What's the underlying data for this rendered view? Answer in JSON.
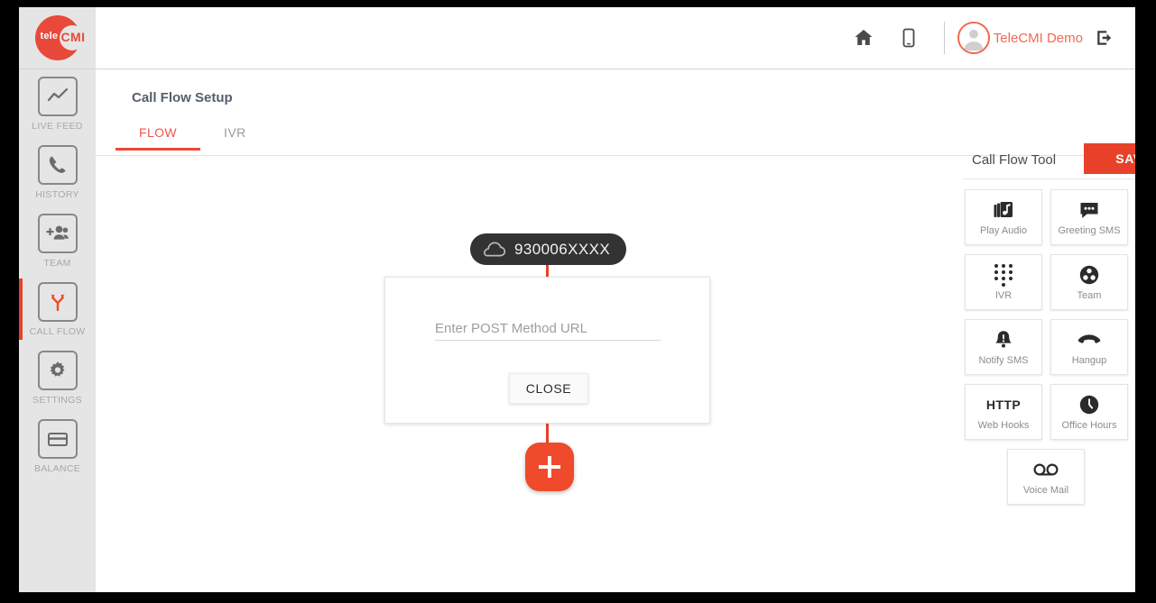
{
  "brand": {
    "logo_tele": "tele",
    "logo_cmi": "CMI",
    "accent_red": "#e8412a",
    "accent_coral": "#ef6a52"
  },
  "topbar": {
    "home_icon": "home-icon",
    "mobile_icon": "mobile-icon",
    "avatar_icon": "user-avatar-icon",
    "user_name": "TeleCMI Demo",
    "logout_icon": "logout-icon"
  },
  "sidebar": {
    "items": [
      {
        "label": "LIVE FEED",
        "icon": "line-chart-icon",
        "active": false
      },
      {
        "label": "HISTORY",
        "icon": "phone-icon",
        "active": false
      },
      {
        "label": "TEAM",
        "icon": "add-people-icon",
        "active": false
      },
      {
        "label": "CALL FLOW",
        "icon": "call-flow-branch-icon",
        "active": true
      },
      {
        "label": "SETTINGS",
        "icon": "gear-icon",
        "active": false
      },
      {
        "label": "BALANCE",
        "icon": "credit-card-icon",
        "active": false
      }
    ]
  },
  "main": {
    "page_title": "Call Flow Setup",
    "tabs": [
      {
        "label": "FLOW",
        "active": true
      },
      {
        "label": "IVR",
        "active": false
      }
    ]
  },
  "flow": {
    "number_node": {
      "icon": "cloud-icon",
      "number": "930006XXXX"
    },
    "url_card": {
      "input_placeholder": "Enter POST Method URL",
      "input_value": "",
      "close_label": "CLOSE"
    },
    "add_button": {
      "icon": "plus-icon",
      "label": "+"
    }
  },
  "tool_panel": {
    "title": "Call Flow Tool",
    "save_label": "SAVE",
    "tools": [
      {
        "label": "Play Audio",
        "icon": "music-library-icon"
      },
      {
        "label": "Greeting SMS",
        "icon": "chat-bubble-icon"
      },
      {
        "label": "IVR",
        "icon": "dialpad-icon"
      },
      {
        "label": "Team",
        "icon": "team-circle-icon"
      },
      {
        "label": "Notify SMS",
        "icon": "bell-alert-icon"
      },
      {
        "label": "Hangup",
        "icon": "hangup-phone-icon"
      },
      {
        "label": "Web Hooks",
        "icon": "http-text-icon"
      },
      {
        "label": "Office Hours",
        "icon": "clock-icon"
      },
      {
        "label": "Voice Mail",
        "icon": "voicemail-icon"
      }
    ]
  }
}
